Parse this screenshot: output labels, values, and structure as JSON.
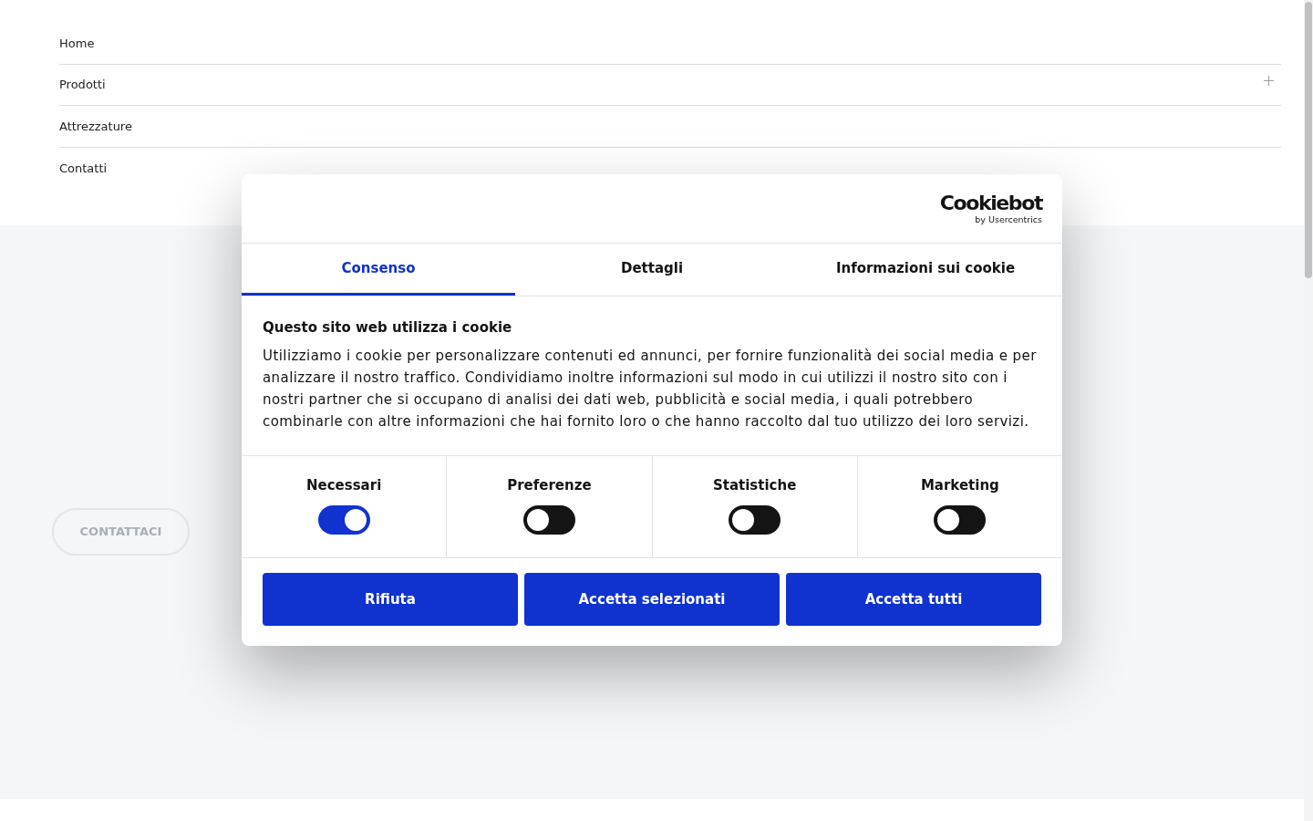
{
  "nav": {
    "items": [
      {
        "label": "Home",
        "has_submenu": false
      },
      {
        "label": "Prodotti",
        "has_submenu": true
      },
      {
        "label": "Attrezzature",
        "has_submenu": false
      },
      {
        "label": "Contatti",
        "has_submenu": false
      }
    ]
  },
  "hero": {
    "button": "CONTATTACI"
  },
  "cookie_dialog": {
    "logo": {
      "name": "Cookiebot",
      "tagline": "by Usercentrics"
    },
    "tabs": [
      {
        "label": "Consenso",
        "selected": true
      },
      {
        "label": "Dettagli",
        "selected": false
      },
      {
        "label": "Informazioni sui cookie",
        "selected": false
      }
    ],
    "title": "Questo sito web utilizza i cookie",
    "text": "Utilizziamo i cookie per personalizzare contenuti ed annunci, per fornire funzionalità dei social media e per analizzare il nostro traffico. Condividiamo inoltre informazioni sul modo in cui utilizzi il nostro sito con i nostri partner che si occupano di analisi dei dati web, pubblicità e social media, i quali potrebbero combinarle con altre informazioni che hai fornito loro o che hanno raccolto dal tuo utilizzo dei loro servizi.",
    "categories": [
      {
        "label": "Necessari",
        "on": true
      },
      {
        "label": "Preferenze",
        "on": false
      },
      {
        "label": "Statistiche",
        "on": false
      },
      {
        "label": "Marketing",
        "on": false
      }
    ],
    "buttons": [
      "Rifiuta",
      "Accetta selezionati",
      "Accetta tutti"
    ]
  }
}
